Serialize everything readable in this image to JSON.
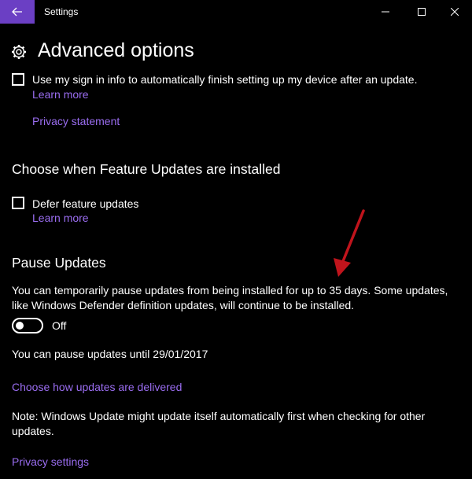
{
  "window": {
    "title": "Settings"
  },
  "page": {
    "title": "Advanced options"
  },
  "signin": {
    "label": "Use my sign in info to automatically finish setting up my device after an update.",
    "checked": false,
    "learn_more": "Learn more",
    "privacy_statement": "Privacy statement"
  },
  "feature_updates": {
    "heading": "Choose when Feature Updates are installed",
    "defer_label": "Defer feature updates",
    "checked": false,
    "learn_more": "Learn more"
  },
  "pause": {
    "heading": "Pause Updates",
    "description": "You can temporarily pause updates from being installed for up to 35 days. Some updates, like Windows Defender definition updates, will continue to be installed.",
    "toggle_state": "Off",
    "until_text": "You can pause updates until 29/01/2017"
  },
  "links": {
    "delivery": "Choose how updates are delivered",
    "privacy_settings": "Privacy settings"
  },
  "note": "Note: Windows Update might update itself automatically first when checking for other updates.",
  "colors": {
    "accent": "#6b3fc4",
    "link": "#9a6df0",
    "annotation_arrow": "#c0141c"
  }
}
